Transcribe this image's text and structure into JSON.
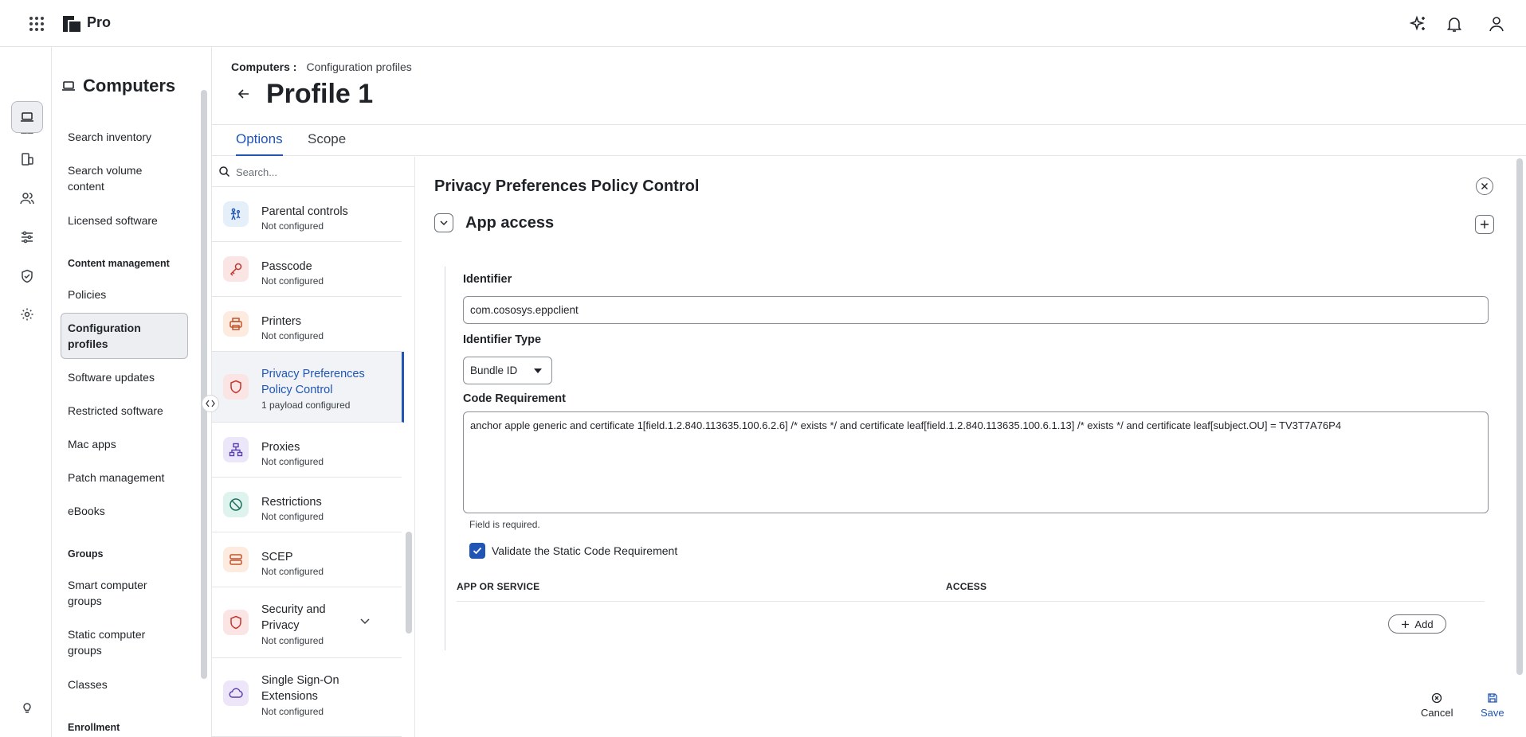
{
  "app": {
    "brand": "Pro"
  },
  "leftnav": {
    "title": "Computers",
    "items": [
      {
        "label": "Search inventory"
      },
      {
        "label": "Search volume content"
      },
      {
        "label": "Licensed software"
      }
    ],
    "content_management": {
      "heading": "Content management",
      "items": [
        {
          "label": "Policies"
        },
        {
          "label": "Configuration profiles"
        },
        {
          "label": "Software updates"
        },
        {
          "label": "Restricted software"
        },
        {
          "label": "Mac apps"
        },
        {
          "label": "Patch management"
        },
        {
          "label": "eBooks"
        }
      ]
    },
    "groups": {
      "heading": "Groups",
      "items": [
        {
          "label": "Smart computer groups"
        },
        {
          "label": "Static computer groups"
        },
        {
          "label": "Classes"
        }
      ]
    },
    "enrollment": {
      "heading": "Enrollment"
    }
  },
  "breadcrumb": {
    "section": "Computers :",
    "current": "Configuration profiles"
  },
  "page": {
    "title": "Profile 1"
  },
  "tabs": [
    {
      "label": "Options"
    },
    {
      "label": "Scope"
    }
  ],
  "payloads": {
    "search_placeholder": "Search...",
    "items": [
      {
        "name": "Parental controls",
        "status": "Not configured",
        "icon": "parental-controls-icon"
      },
      {
        "name": "Passcode",
        "status": "Not configured",
        "icon": "key-icon"
      },
      {
        "name": "Printers",
        "status": "Not configured",
        "icon": "printer-icon"
      },
      {
        "name": "Privacy Preferences Policy Control",
        "status": "1 payload configured",
        "icon": "shield-icon"
      },
      {
        "name": "Proxies",
        "status": "Not configured",
        "icon": "network-icon"
      },
      {
        "name": "Restrictions",
        "status": "Not configured",
        "icon": "restricted-icon"
      },
      {
        "name": "SCEP",
        "status": "Not configured",
        "icon": "server-icon"
      },
      {
        "name": "Security and Privacy",
        "status": "Not configured",
        "icon": "shield-icon"
      },
      {
        "name": "Single Sign-On Extensions",
        "status": "Not configured",
        "icon": "cloud-icon"
      }
    ]
  },
  "editor": {
    "title": "Privacy Preferences Policy Control",
    "section_title": "App access",
    "identifier_label": "Identifier",
    "identifier_value": "com.cososys.eppclient",
    "identifier_type_label": "Identifier Type",
    "identifier_type_value": "Bundle ID",
    "code_requirement_label": "Code Requirement",
    "code_requirement_value": "anchor apple generic and certificate 1[field.1.2.840.113635.100.6.2.6] /* exists */ and certificate leaf[field.1.2.840.113635.100.6.1.13] /* exists */ and certificate leaf[subject.OU] = TV3T7A76P4",
    "code_requirement_hint": "Field is required.",
    "validate_label": "Validate the Static Code Requirement",
    "validate_checked": true,
    "table_headers": {
      "app_or_service": "APP OR SERVICE",
      "access": "ACCESS"
    },
    "add_label": "Add",
    "cancel_label": "Cancel",
    "save_label": "Save"
  },
  "colors": {
    "accent": "#2055b5",
    "text": "#1f2328",
    "border": "#e3e5e8"
  }
}
